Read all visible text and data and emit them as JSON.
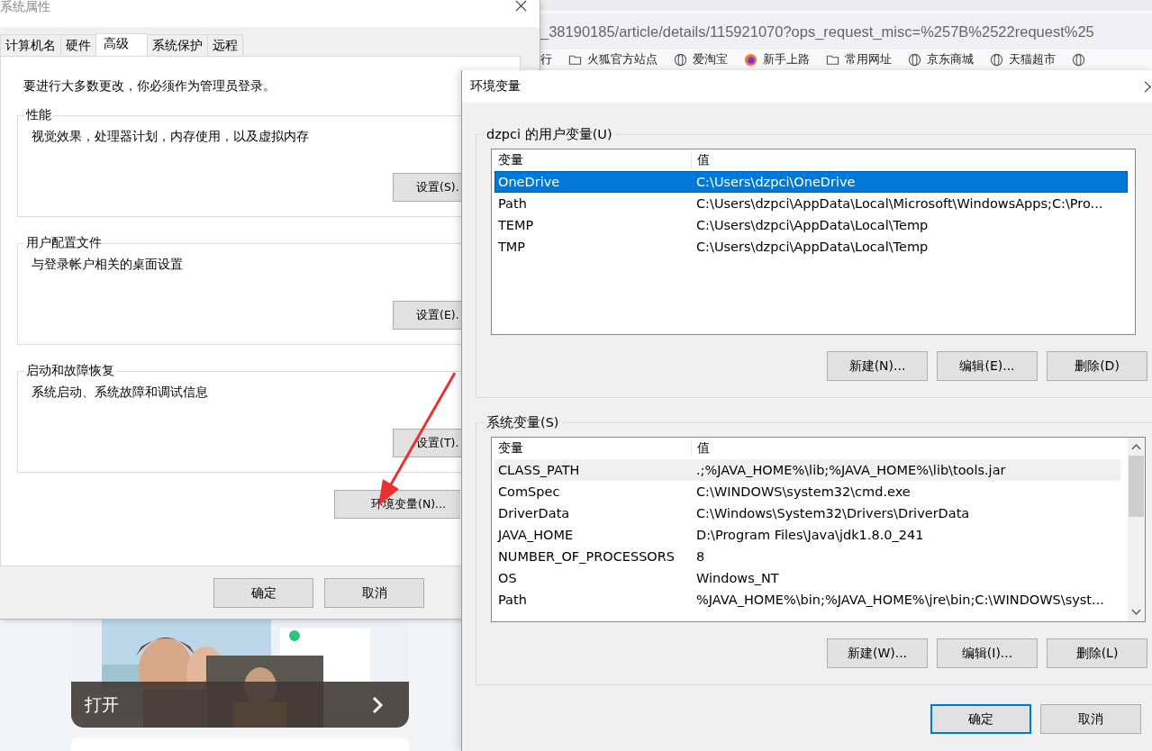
{
  "browser": {
    "url": "_38190185/article/details/115921070?ops_request_misc=%257B%2522request%25",
    "bookmarks": [
      {
        "label": "行",
        "kind": "text"
      },
      {
        "label": "火狐官方站点",
        "kind": "folder"
      },
      {
        "label": "爱淘宝",
        "kind": "globe"
      },
      {
        "label": "新手上路",
        "kind": "firefox"
      },
      {
        "label": "常用网址",
        "kind": "folder"
      },
      {
        "label": "京东商城",
        "kind": "globe"
      },
      {
        "label": "天猫超市",
        "kind": "globe"
      },
      {
        "kind": "globe"
      }
    ]
  },
  "promo_card": {
    "kind": "picture",
    "button": "打开"
  },
  "system_properties": {
    "title": "系统属性",
    "tabs": [
      {
        "label": "计算机名",
        "selected": false
      },
      {
        "label": "硬件",
        "selected": false
      },
      {
        "label": "高级",
        "selected": true
      },
      {
        "label": "系统保护",
        "selected": false
      },
      {
        "label": "远程",
        "selected": false
      }
    ],
    "notice": "要进行大多数更改，你必须作为管理员登录。",
    "groups": [
      {
        "title": "性能",
        "description": "视觉效果，处理器计划，内存使用，以及虚拟内存",
        "button": "设置(S)."
      },
      {
        "title": "用户配置文件",
        "description": "与登录帐户相关的桌面设置",
        "button": "设置(E)."
      },
      {
        "title": "启动和故障恢复",
        "description": "系统启动、系统故障和调试信息",
        "button": "设置(T)."
      }
    ],
    "env_button": "环境变量(N)...",
    "buttons": [
      "确定",
      "取消"
    ]
  },
  "env_dialog": {
    "title": "环境变量",
    "user_vars": {
      "title": "dzpci 的用户变量(U)",
      "focused": true,
      "columns": [
        "变量",
        "值"
      ],
      "rows": [
        {
          "name": "OneDrive",
          "value": "C:\\Users\\dzpci\\OneDrive",
          "selected": true
        },
        {
          "name": "Path",
          "value": "C:\\Users\\dzpci\\AppData\\Local\\Microsoft\\WindowsApps;C:\\Pro...",
          "selected": false
        },
        {
          "name": "TEMP",
          "value": "C:\\Users\\dzpci\\AppData\\Local\\Temp",
          "selected": false
        },
        {
          "name": "TMP",
          "value": "C:\\Users\\dzpci\\AppData\\Local\\Temp",
          "selected": false
        }
      ],
      "buttons": [
        "新建(N)...",
        "编辑(E)...",
        "删除(D)"
      ]
    },
    "system_vars": {
      "title": "系统变量(S)",
      "focused": false,
      "columns": [
        "变量",
        "值"
      ],
      "rows": [
        {
          "name": "CLASS_PATH",
          "value": ".;%JAVA_HOME%\\lib;%JAVA_HOME%\\lib\\tools.jar",
          "selected": true
        },
        {
          "name": "ComSpec",
          "value": "C:\\WINDOWS\\system32\\cmd.exe",
          "selected": false
        },
        {
          "name": "DriverData",
          "value": "C:\\Windows\\System32\\Drivers\\DriverData",
          "selected": false
        },
        {
          "name": "JAVA_HOME",
          "value": "D:\\Program Files\\Java\\jdk1.8.0_241",
          "selected": false
        },
        {
          "name": "NUMBER_OF_PROCESSORS",
          "value": "8",
          "selected": false
        },
        {
          "name": "OS",
          "value": "Windows_NT",
          "selected": false
        },
        {
          "name": "Path",
          "value": "%JAVA_HOME%\\bin;%JAVA_HOME%\\jre\\bin;C:\\WINDOWS\\syst...",
          "selected": false
        }
      ],
      "buttons": [
        "新建(W)...",
        "编辑(I)...",
        "删除(L)"
      ]
    },
    "buttons": [
      {
        "label": "确定",
        "default": true
      },
      {
        "label": "取消",
        "default": false
      }
    ]
  }
}
